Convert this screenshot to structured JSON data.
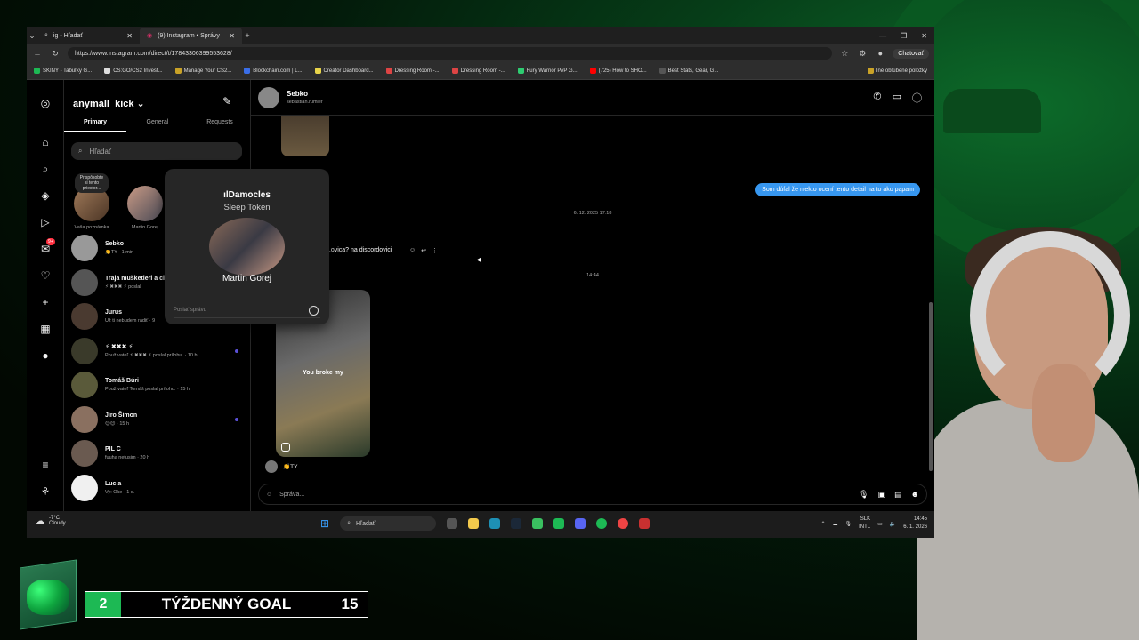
{
  "browser": {
    "tabs": [
      {
        "label": "ig - Hľadať",
        "active": false
      },
      {
        "label": "(9) Instagram • Správy",
        "active": true
      }
    ],
    "url": "https://www.instagram.com/direct/t/17843306399553628/",
    "chat_button": "Chatovať",
    "bookmarks": [
      "SKINY - Tabuľky G...",
      "CS:GO/CS2 Invest...",
      "Manage Your CS2...",
      "Blockchain.com | L...",
      "Creator Dashboard...",
      "Dressing Room -...",
      "Dressing Room -...",
      "Fury Warrior PvP G...",
      "(725) How to SHO...",
      "Best Stats, Gear, G..."
    ],
    "bookmarks_other": "Iné obľúbené položky"
  },
  "inbox": {
    "username": "anymall_kick",
    "tabs": [
      "Primary",
      "General",
      "Requests"
    ],
    "search_placeholder": "Hľadať",
    "notes": [
      {
        "bubble": "Prispôsobte si tento priestor...",
        "label": "Vaša poznámka"
      },
      {
        "bubble": "",
        "label": "Martin Gorej"
      }
    ],
    "threads": [
      {
        "name": "Sebko",
        "sub": "👏TY · 1 min",
        "unread": false
      },
      {
        "name": "Traja mušketieri a ci",
        "sub": "⚡ ✖✖✖ ⚡ poslal",
        "unread": false
      },
      {
        "name": "Jurus",
        "sub": "Už ti nebudem radiť · 9",
        "unread": false
      },
      {
        "name": "⚡ ✖✖✖ ⚡",
        "sub": "Používateľ ⚡ ✖✖✖ ⚡ poslal prílohu. · 10 h",
        "unread": true
      },
      {
        "name": "Tomáš Búri",
        "sub": "Používateľ Tomáš poslal prílohu. · 15 h",
        "unread": false
      },
      {
        "name": "Jiro Šimon",
        "sub": "😊😊 · 15 h",
        "unread": true
      },
      {
        "name": "PIL C",
        "sub": "fuuha netusim · 20 h",
        "unread": false
      },
      {
        "name": "Lucia",
        "sub": "Vy: Oke · 1 d.",
        "unread": false
      }
    ],
    "rail_badge": "9+"
  },
  "popup": {
    "song": "Damocles",
    "artist": "Sleep Token",
    "name": "Martin Gorej",
    "reply_placeholder": "Poslať správu"
  },
  "chat": {
    "name": "Sebko",
    "username": "sebastian.rumler",
    "outgoing": "Som dúfal že niekto ocení tento detail na to ako papam",
    "timestamp1": "6. 12. 2025 17:18",
    "incoming_partial": "...ovica? na discordovici",
    "timestamp2": "14:44",
    "reel_caption": "You broke my",
    "reaction": "👏TY",
    "composer_placeholder": "Správa..."
  },
  "taskbar": {
    "temp": "-7°C",
    "weather": "Cloudy",
    "search": "Hľadať",
    "lang1": "SLK",
    "lang2": "INTL",
    "time": "14:45",
    "date": "6. 1. 2026"
  },
  "overlay": {
    "goal_current": "2",
    "goal_label": "TÝŽDENNÝ GOAL",
    "goal_target": "15"
  },
  "colors": {
    "accent_blue": "#3797f0",
    "goal_green": "#1db954",
    "badge_red": "#ff3040"
  }
}
